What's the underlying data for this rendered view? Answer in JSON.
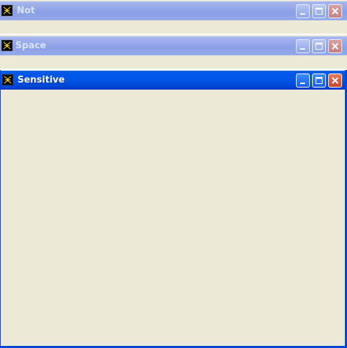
{
  "windows": [
    {
      "title": "Not",
      "state": "inactive",
      "icon": "app-icon",
      "buttons": [
        "minimize-icon",
        "maximize-icon",
        "close-icon"
      ]
    },
    {
      "title": "Space",
      "state": "inactive",
      "icon": "app-icon",
      "buttons": [
        "minimize-icon",
        "maximize-icon",
        "close-icon"
      ]
    },
    {
      "title": "Sensitive",
      "state": "active",
      "icon": "app-icon",
      "buttons": [
        "minimize-icon",
        "maximize-icon",
        "close-icon"
      ]
    }
  ],
  "colors": {
    "client_bg": "#ece9d8",
    "active_titlebar": "#0055e5",
    "inactive_titlebar": "#95a8ea",
    "close_button_active": "#c8442a"
  }
}
